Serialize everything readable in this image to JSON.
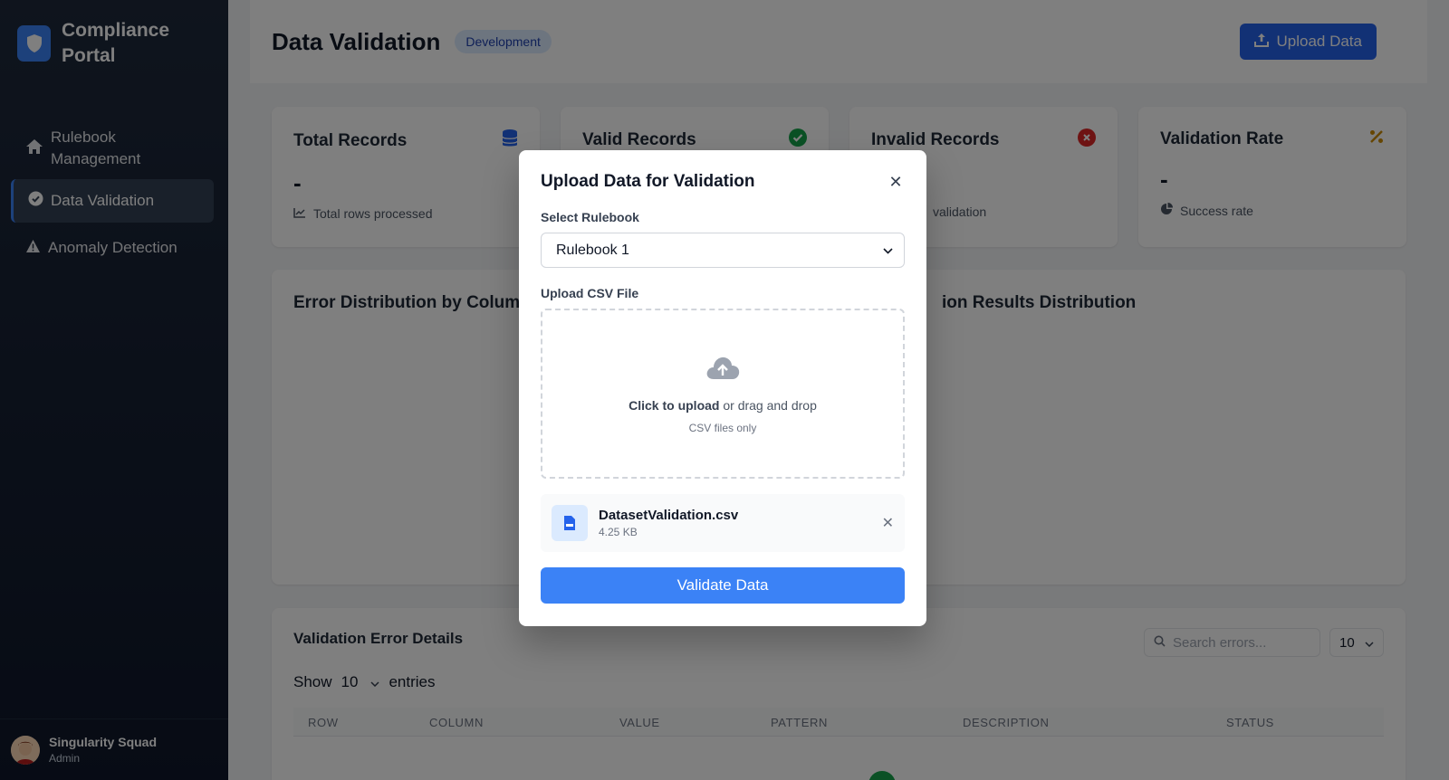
{
  "sidebar": {
    "brand": "Compliance Portal",
    "items": [
      {
        "label": "Rulebook Management",
        "icon": "home-icon"
      },
      {
        "label": "Data Validation",
        "icon": "check-circle-icon"
      },
      {
        "label": "Anomaly Detection",
        "icon": "warning-icon"
      }
    ],
    "user": {
      "name": "Singularity Squad",
      "role": "Admin"
    }
  },
  "header": {
    "title": "Data Validation",
    "badge": "Development",
    "upload_label": "Upload Data"
  },
  "stats": [
    {
      "title": "Total Records",
      "value": "-",
      "sub": "Total rows processed",
      "icon": "database-icon",
      "color": "#2563eb"
    },
    {
      "title": "Valid Records",
      "value": "-",
      "sub": "",
      "icon": "check-circle-icon",
      "color": "#16a34a"
    },
    {
      "title": "Invalid Records",
      "value": "-",
      "sub": "validation",
      "icon": "x-circle-icon",
      "color": "#dc2626"
    },
    {
      "title": "Validation Rate",
      "value": "-",
      "sub": "Success rate",
      "icon": "percent-icon",
      "color": "#ca8a04"
    }
  ],
  "charts": {
    "left_title": "Error Distribution by Column",
    "right_title": "ion Results Distribution"
  },
  "table": {
    "title": "Validation Error Details",
    "search_placeholder": "Search errors...",
    "page_size": "10",
    "show_label": "Show",
    "show_value": "10",
    "entries_label": "entries",
    "columns": [
      "ROW",
      "COLUMN",
      "VALUE",
      "PATTERN",
      "DESCRIPTION",
      "STATUS"
    ]
  },
  "modal": {
    "title": "Upload Data for Validation",
    "rulebook_label": "Select Rulebook",
    "rulebook_value": "Rulebook 1",
    "file_label": "Upload CSV File",
    "dz_bold": "Click to upload",
    "dz_rest": " or drag and drop",
    "dz_sub": "CSV files only",
    "file_name": "DatasetValidation.csv",
    "file_size": "4.25 KB",
    "validate_label": "Validate Data"
  }
}
